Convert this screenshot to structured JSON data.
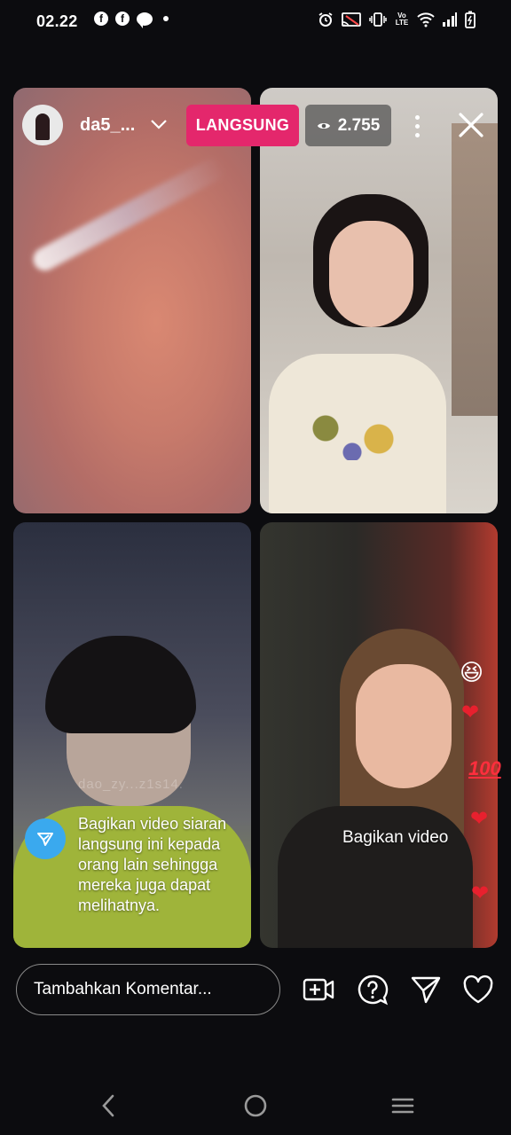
{
  "status_bar": {
    "time": "02.22",
    "left_icons": [
      "facebook-icon",
      "facebook-icon",
      "message-icon",
      "dot-icon"
    ],
    "right_icons": [
      "alarm-icon",
      "cast-icon",
      "vibrate-icon",
      "volte-icon",
      "wifi-icon",
      "signal-icon",
      "battery-charging-icon"
    ],
    "facebook_glyph": "f",
    "volte_label": "Vo LTE"
  },
  "live_header": {
    "username": "da5_...",
    "live_label": "LANGSUNG",
    "viewer_count": "2.755",
    "live_color": "#e4276c"
  },
  "tiles": [
    {
      "name": "host-stream"
    },
    {
      "name": "guest-stream-1"
    },
    {
      "name": "guest-stream-2"
    },
    {
      "name": "guest-stream-3"
    }
  ],
  "overlay": {
    "faint_name": "dao_zy...z1s14.",
    "share_prompt": "Bagikan video siaran langsung ini kepada orang lain sehingga mereka juga dapat melihatnya.",
    "share_video_label": "Bagikan video",
    "share_accent": "#3aa9ee"
  },
  "reactions": {
    "laugh": "😆",
    "heart": "❤",
    "hundred": "100"
  },
  "comment_bar": {
    "placeholder": "Tambahkan Komentar...",
    "actions": [
      "add-video-icon",
      "question-icon",
      "send-icon",
      "heart-icon"
    ]
  },
  "nav_bar": {
    "buttons": [
      "back-icon",
      "home-icon",
      "recents-icon"
    ]
  }
}
